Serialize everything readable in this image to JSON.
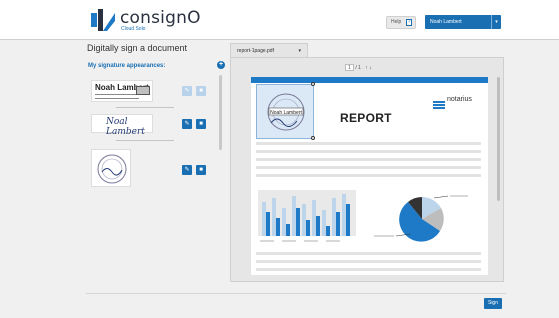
{
  "header": {
    "brand": "consignO",
    "brand_sub": "Cloud Solo",
    "help_label": "Help",
    "help_icon": "?",
    "user_name": "Noah Lambert",
    "user_caret": "▾"
  },
  "main": {
    "title": "Digitally sign a document",
    "appearances_title": "My signature appearances:",
    "add_icon": "+"
  },
  "signatures": {
    "one": {
      "name": "Noah Lambert"
    },
    "two": {
      "handwritten": "Noal Lambert"
    }
  },
  "document": {
    "tab_label": "report-1page.pdf",
    "tab_caret": "▾",
    "page_current": "1",
    "page_total": "/ 1",
    "page_arrows": "↑ ↓",
    "report_title": "REPORT",
    "logo_text": "notarius"
  },
  "actions": {
    "sign_label": "Sign"
  },
  "colors": {
    "accent": "#1a6fb3",
    "band": "#1e7ac7"
  }
}
